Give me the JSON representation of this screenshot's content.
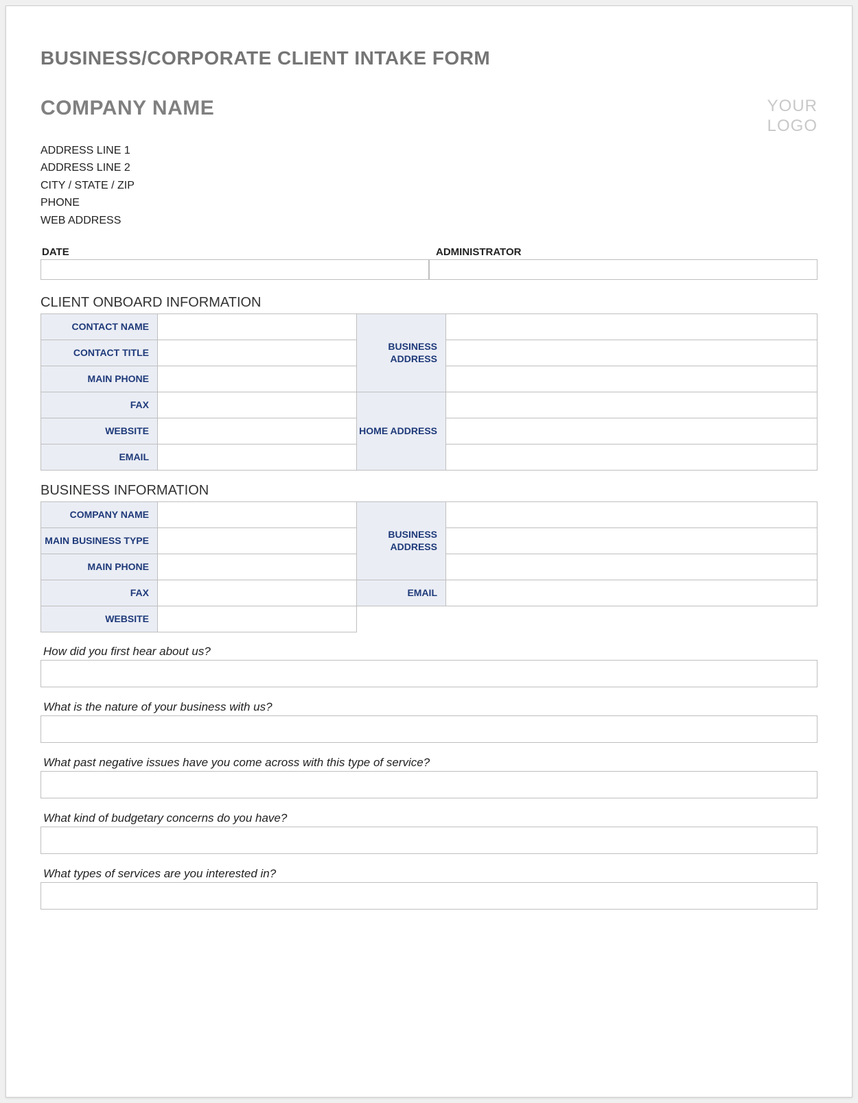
{
  "form_title": "BUSINESS/CORPORATE CLIENT INTAKE FORM",
  "company_header": "COMPANY NAME",
  "logo_placeholder_line1": "YOUR",
  "logo_placeholder_line2": "LOGO",
  "address": {
    "line1": "ADDRESS LINE 1",
    "line2": "ADDRESS LINE 2",
    "city_state_zip": "CITY / STATE / ZIP",
    "phone": "PHONE",
    "web": "WEB ADDRESS"
  },
  "date_label": "DATE",
  "admin_label": "ADMINISTRATOR",
  "date_value": "",
  "admin_value": "",
  "section_client_onboard": "CLIENT ONBOARD INFORMATION",
  "client": {
    "labels": {
      "contact_name": "CONTACT NAME",
      "contact_title": "CONTACT TITLE",
      "main_phone": "MAIN PHONE",
      "fax": "FAX",
      "website": "WEBSITE",
      "email": "EMAIL",
      "business_address": "BUSINESS ADDRESS",
      "home_address": "HOME ADDRESS"
    },
    "values": {
      "contact_name": "",
      "contact_title": "",
      "main_phone": "",
      "fax": "",
      "website": "",
      "email": "",
      "business_addr1": "",
      "business_addr2": "",
      "business_addr3": "",
      "home_addr1": "",
      "home_addr2": "",
      "home_addr3": ""
    }
  },
  "section_business_info": "BUSINESS INFORMATION",
  "business": {
    "labels": {
      "company_name": "COMPANY NAME",
      "main_business_type": "MAIN BUSINESS TYPE",
      "main_phone": "MAIN PHONE",
      "fax": "FAX",
      "website": "WEBSITE",
      "business_address": "BUSINESS ADDRESS",
      "email": "EMAIL"
    },
    "values": {
      "company_name": "",
      "main_business_type": "",
      "main_phone": "",
      "fax": "",
      "website": "",
      "business_addr1": "",
      "business_addr2": "",
      "business_addr3": "",
      "email": ""
    }
  },
  "questions": {
    "q1": "How did you first hear about us?",
    "q2": "What is the nature of your business with us?",
    "q3": "What past negative issues have you come across with this type of service?",
    "q4": "What kind of budgetary concerns do you have?",
    "q5": "What types of services are you interested in?"
  },
  "answers": {
    "q1": "",
    "q2": "",
    "q3": "",
    "q4": "",
    "q5": ""
  }
}
